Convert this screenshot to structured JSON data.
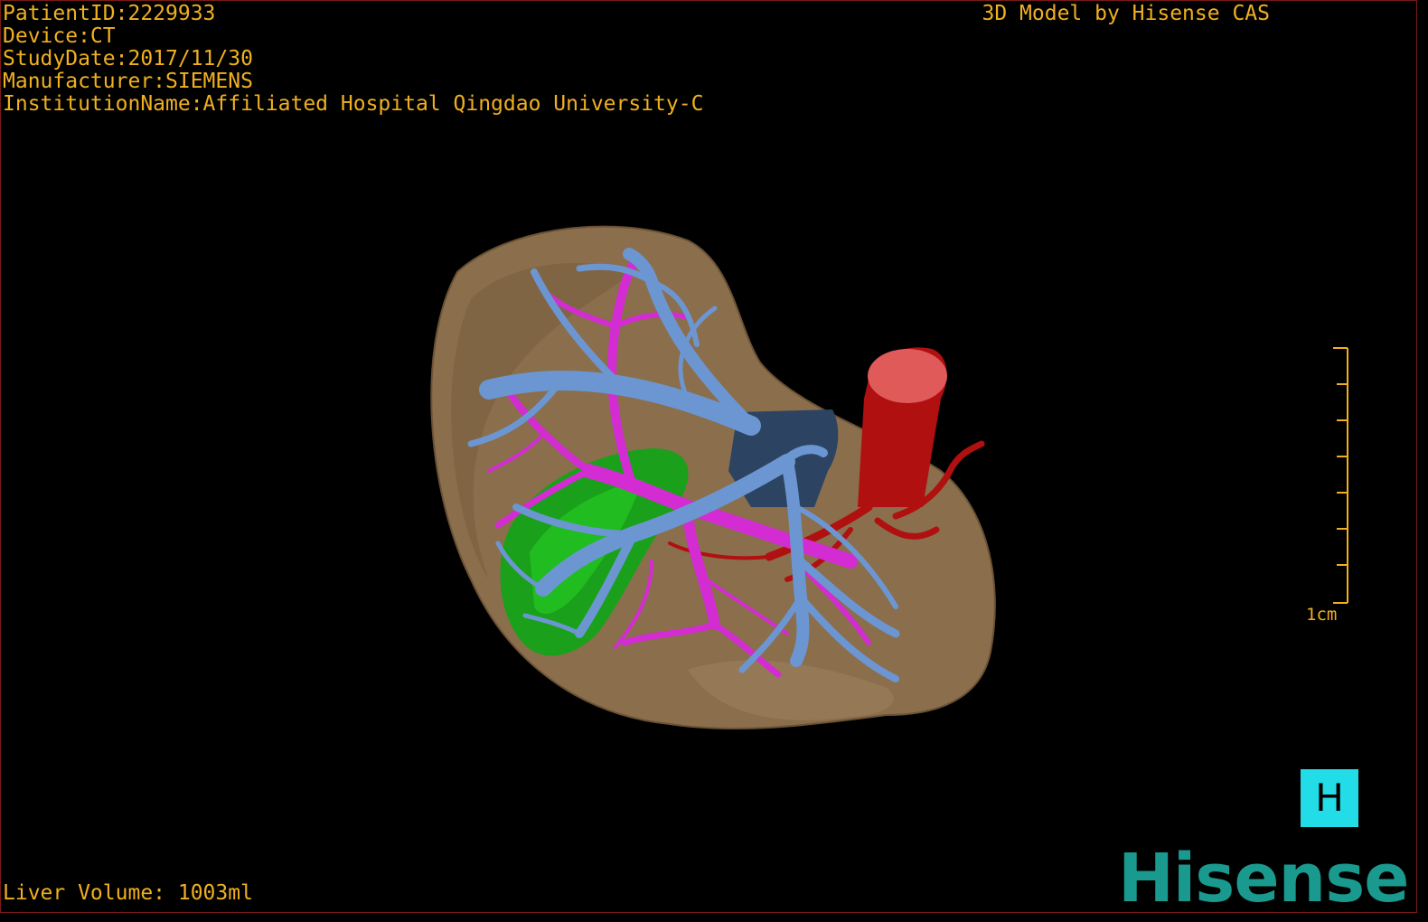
{
  "header": {
    "patient_id": "PatientID:2229933",
    "device": "Device:CT",
    "study_date": "StudyDate:2017/11/30",
    "manufacturer": "Manufacturer:SIEMENS",
    "institution": "InstitutionName:Affiliated Hospital Qingdao University-C",
    "brand_caption": "3D Model by Hisense CAS"
  },
  "footer": {
    "liver_volume": "Liver Volume: 1003ml"
  },
  "scale": {
    "label": "1cm"
  },
  "orientation": {
    "label": "H"
  },
  "logo": {
    "text": "Hisense"
  },
  "colors": {
    "overlay_text": "#f0b020",
    "liver": "#8b6e4c",
    "hepatic_vein": "#6c96d2",
    "portal_vein": "#d22cd2",
    "artery": "#b01010",
    "gallbladder": "#1aa01a",
    "ivc": "#2c4462",
    "orientation_cube": "#22dde8",
    "logo": "#1a9a8e"
  }
}
